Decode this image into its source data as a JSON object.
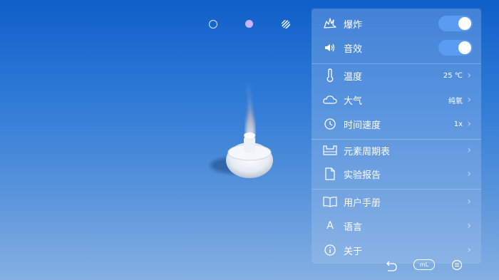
{
  "top_toolbar": {
    "icons": [
      "circle-outline-icon",
      "purple-dot-icon",
      "striped-circle-icon"
    ]
  },
  "colors": {
    "bg_top": "#0f5fc9",
    "bg_bottom": "#84b0e2",
    "toggle_on": "#5b9cf3",
    "dot_purple": "#c9b3ff"
  },
  "menu": {
    "explosion": {
      "label": "爆炸",
      "icon": "explosion-icon",
      "enabled": true
    },
    "sound": {
      "label": "音效",
      "icon": "speaker-icon",
      "enabled": true
    },
    "temperature": {
      "label": "温度",
      "icon": "thermometer-icon",
      "value": "25 ℃"
    },
    "atmosphere": {
      "label": "大气",
      "icon": "cloud-icon",
      "value": "纯氧"
    },
    "time_speed": {
      "label": "时间速度",
      "icon": "clock-icon",
      "value": "1x"
    },
    "periodic_table": {
      "label": "元素周期表",
      "icon": "periodic-table-icon"
    },
    "lab_report": {
      "label": "实验报告",
      "icon": "document-icon"
    },
    "user_manual": {
      "label": "用户手册",
      "icon": "book-icon"
    },
    "language": {
      "label": "语言",
      "icon": "letter-a-icon",
      "glyph": "A"
    },
    "about": {
      "label": "关于",
      "icon": "info-icon"
    }
  },
  "bottom_toolbar": {
    "ml_label": "mL",
    "icons": [
      "undo-icon",
      "ml-icon",
      "menu-icon"
    ]
  }
}
